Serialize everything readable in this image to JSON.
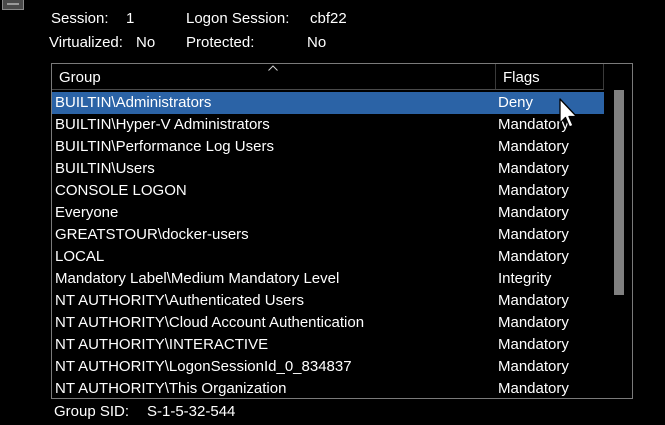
{
  "info": {
    "session_label": "Session:",
    "session_value": "1",
    "logon_session_label": "Logon Session:",
    "logon_session_value": "cbf22",
    "virtualized_label": "Virtualized:",
    "virtualized_value": "No",
    "protected_label": "Protected:",
    "protected_value": "No"
  },
  "table": {
    "columns": [
      "Group",
      "Flags"
    ],
    "sort_icon": "sort-ascending-icon",
    "selected_row_color": "#2b63a6",
    "rows": [
      {
        "group": "BUILTIN\\Administrators",
        "flags": "Deny"
      },
      {
        "group": "BUILTIN\\Hyper-V Administrators",
        "flags": "Mandatory"
      },
      {
        "group": "BUILTIN\\Performance Log Users",
        "flags": "Mandatory"
      },
      {
        "group": "BUILTIN\\Users",
        "flags": "Mandatory"
      },
      {
        "group": "CONSOLE LOGON",
        "flags": "Mandatory"
      },
      {
        "group": "Everyone",
        "flags": "Mandatory"
      },
      {
        "group": "GREATSTOUR\\docker-users",
        "flags": "Mandatory"
      },
      {
        "group": "LOCAL",
        "flags": "Mandatory"
      },
      {
        "group": "Mandatory Label\\Medium Mandatory Level",
        "flags": "Integrity"
      },
      {
        "group": "NT AUTHORITY\\Authenticated Users",
        "flags": "Mandatory"
      },
      {
        "group": "NT AUTHORITY\\Cloud Account Authentication",
        "flags": "Mandatory"
      },
      {
        "group": "NT AUTHORITY\\INTERACTIVE",
        "flags": "Mandatory"
      },
      {
        "group": "NT AUTHORITY\\LogonSessionId_0_834837",
        "flags": "Mandatory"
      },
      {
        "group": "NT AUTHORITY\\This Organization",
        "flags": "Mandatory"
      }
    ]
  },
  "footer": {
    "group_sid_label": "Group SID:",
    "group_sid_value": "S-1-5-32-544"
  }
}
